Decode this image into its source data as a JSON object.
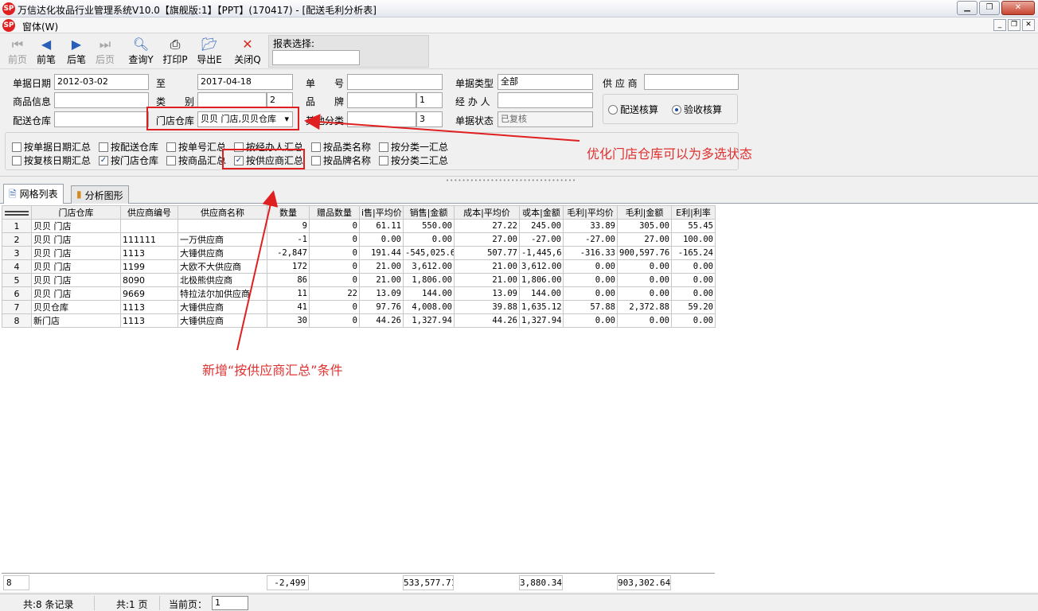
{
  "window": {
    "title": "万信达化妆品行业管理系统V10.0【旗舰版:1】【PPT】(170417) - [配送毛利分析表]",
    "menu": "窗体(W)",
    "logo_text": "SP"
  },
  "toolbar": {
    "first": "前页",
    "prev": "前笔",
    "next": "后笔",
    "last": "后页",
    "query": "查询Y",
    "print": "打印P",
    "export": "导出E",
    "close": "关闭Q",
    "report_select_label": "报表选择:",
    "report_select_value": ""
  },
  "filters": {
    "date_label": "单据日期",
    "date_from": "2012-03-02",
    "to_label": "至",
    "date_to": "2017-04-18",
    "doc_no_label": "单　　号",
    "doc_no": "",
    "doc_type_label": "单据类型",
    "doc_type": "全部",
    "supplier_label": "供 应 商",
    "supplier": "",
    "goods_label": "商品信息",
    "goods": "",
    "category_label": "类　　别",
    "category": "",
    "category_level": "2",
    "brand_label": "品　　牌",
    "brand": "",
    "brand_level": "1",
    "handler_label": "经 办 人",
    "handler": "",
    "dist_wh_label": "配送仓库",
    "dist_wh": "",
    "store_wh_label": "门店仓库",
    "store_wh": "贝贝 门店,贝贝仓库",
    "other_cat_label": "其他分类",
    "other_cat": "",
    "other_cat_level": "3",
    "doc_status_label": "单据状态",
    "doc_status": "已复核",
    "radio_options": [
      {
        "label": "配送核算",
        "checked": false
      },
      {
        "label": "验收核算",
        "checked": true
      }
    ],
    "checkboxes": [
      {
        "label": "按单据日期汇总",
        "checked": false
      },
      {
        "label": "按配送仓库",
        "checked": false
      },
      {
        "label": "按单号汇总",
        "checked": false
      },
      {
        "label": "按经办人汇总",
        "checked": false
      },
      {
        "label": "按品类名称",
        "checked": false
      },
      {
        "label": "按分类一汇总",
        "checked": false
      },
      {
        "label": "按复核日期汇总",
        "checked": false
      },
      {
        "label": "按门店仓库",
        "checked": true
      },
      {
        "label": "按商品汇总",
        "checked": false
      },
      {
        "label": "按供应商汇总",
        "checked": true
      },
      {
        "label": "按品牌名称",
        "checked": false
      },
      {
        "label": "按分类二汇总",
        "checked": false
      }
    ]
  },
  "tabs": [
    {
      "label": "网格列表",
      "icon": "document-icon",
      "active": true
    },
    {
      "label": "分析图形",
      "icon": "chart-icon",
      "active": false
    }
  ],
  "grid": {
    "columns": [
      "门店仓库",
      "供应商编号",
      "供应商名称",
      "数量",
      "赠品数量",
      "销售|平均价",
      "销售|金额",
      "成本|平均价",
      "成本|金额",
      "毛利|平均价",
      "毛利|金额",
      "毛利|利率"
    ],
    "column_display": [
      "门店仓库",
      "供应商编号",
      "供应商名称",
      "数量",
      "赠品数量",
      "i售|平均价",
      "销售|金额",
      "成本|平均价",
      "戓本|金额",
      "毛利|平均价",
      "毛利|金额",
      "E利|利率"
    ],
    "rows": [
      [
        "1",
        "贝贝 门店",
        "",
        "",
        "9",
        "0",
        "61.11",
        "550.00",
        "27.22",
        "245.00",
        "33.89",
        "305.00",
        "55.45"
      ],
      [
        "2",
        "贝贝 门店",
        "111111",
        "一万供应商",
        "-1",
        "0",
        "0.00",
        "0.00",
        "27.00",
        "-27.00",
        "-27.00",
        "27.00",
        "100.00"
      ],
      [
        "3",
        "贝贝 门店",
        "1113",
        "大锤供应商",
        "-2,847",
        "0",
        "191.44",
        "-545,025.6",
        "507.77",
        "-1,445,6",
        "-316.33",
        "900,597.76",
        "-165.24"
      ],
      [
        "4",
        "贝贝 门店",
        "1199",
        "大欧不大供应商",
        "172",
        "0",
        "21.00",
        "3,612.00",
        "21.00",
        "3,612.00",
        "0.00",
        "0.00",
        "0.00"
      ],
      [
        "5",
        "贝贝 门店",
        "8090",
        "北极熊供应商",
        "86",
        "0",
        "21.00",
        "1,806.00",
        "21.00",
        "1,806.00",
        "0.00",
        "0.00",
        "0.00"
      ],
      [
        "6",
        "贝贝 门店",
        "9669",
        "特拉法尔加供应商",
        "11",
        "22",
        "13.09",
        "144.00",
        "13.09",
        "144.00",
        "0.00",
        "0.00",
        "0.00"
      ],
      [
        "7",
        "贝贝仓库",
        "1113",
        "大锤供应商",
        "41",
        "0",
        "97.76",
        "4,008.00",
        "39.88",
        "1,635.12",
        "57.88",
        "2,372.88",
        "59.20"
      ],
      [
        "8",
        "新门店",
        "1113",
        "大锤供应商",
        "30",
        "0",
        "44.26",
        "1,327.94",
        "44.26",
        "1,327.94",
        "0.00",
        "0.00",
        "0.00"
      ]
    ],
    "totals": {
      "count": "8",
      "qty": "-2,499",
      "sales_amount": "533,577.71",
      "cost_amount": "3,880.34",
      "profit_amount": "903,302.64"
    }
  },
  "statusbar": {
    "records": "共:8 条记录",
    "pages": "共:1 页",
    "current_page_label": "当前页：",
    "current_page": "1"
  },
  "annotations": {
    "note1": "优化门店仓库可以为多选状态",
    "note2": "新增“按供应商汇总”条件",
    "color": "#e02020"
  }
}
